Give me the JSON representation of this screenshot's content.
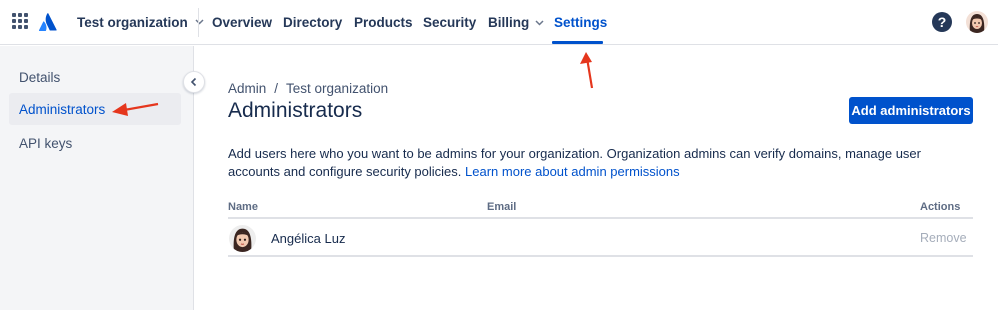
{
  "header": {
    "org_name": "Test organization",
    "nav": [
      "Overview",
      "Directory",
      "Products",
      "Security",
      "Billing",
      "Settings"
    ],
    "active_nav": "Settings",
    "help_label": "?"
  },
  "sidebar": {
    "items": [
      {
        "label": "Details"
      },
      {
        "label": "Administrators",
        "active": true
      },
      {
        "label": "API keys"
      }
    ]
  },
  "main": {
    "breadcrumb": [
      "Admin",
      "/",
      "Test organization"
    ],
    "title": "Administrators",
    "add_button": "Add administrators",
    "description": "Add users here who you want to be admins for your organization. Organization admins can verify domains, manage user accounts and configure security policies.",
    "learn_more": "Learn more about admin permissions",
    "table": {
      "headers": {
        "name": "Name",
        "email": "Email",
        "actions": "Actions"
      },
      "rows": [
        {
          "name": "Angélica Luz",
          "email": "",
          "action": "Remove"
        }
      ]
    }
  },
  "colors": {
    "accent": "#0052cc",
    "annotation": "#e5361d",
    "sidebar_bg": "#f4f5f7",
    "text": "#172b4d"
  }
}
